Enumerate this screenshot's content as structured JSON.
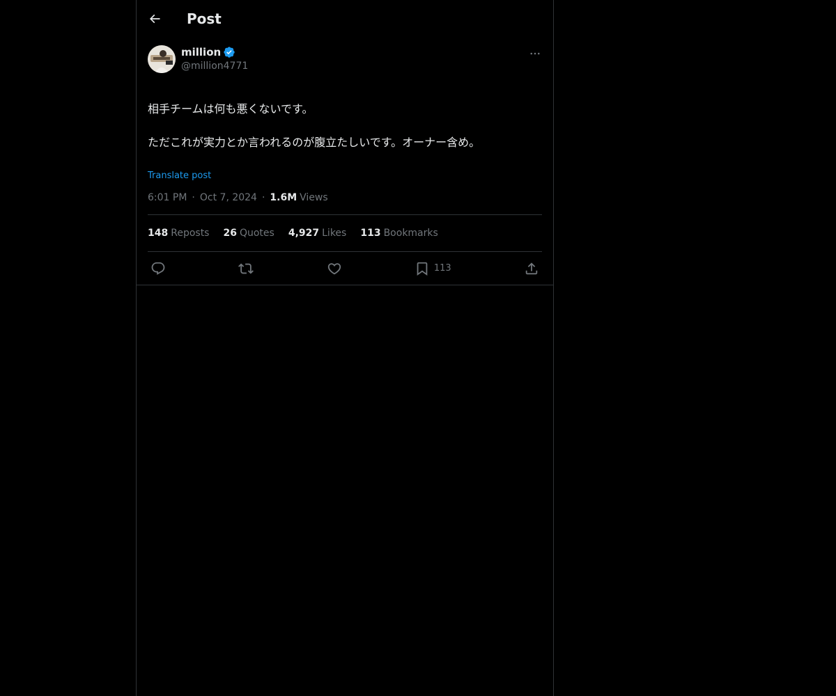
{
  "header": {
    "title": "Post"
  },
  "author": {
    "display_name": "million",
    "handle": "@million4771",
    "verified": true,
    "verified_color": "#1d9bf0"
  },
  "post": {
    "line1": "相手チームは何も悪くないです。",
    "line2": "ただこれが実力とか言われるのが腹立たしいです。オーナー含め。",
    "translate_label": "Translate post"
  },
  "meta": {
    "time": "6:01 PM",
    "date": "Oct 7, 2024",
    "views_count": "1.6M",
    "views_label": "Views"
  },
  "stats": {
    "reposts_count": "148",
    "reposts_label": "Reposts",
    "quotes_count": "26",
    "quotes_label": "Quotes",
    "likes_count": "4,927",
    "likes_label": "Likes",
    "bookmarks_count": "113",
    "bookmarks_label": "Bookmarks"
  },
  "actions": {
    "bookmark_count": "113",
    "icons": [
      "reply-icon",
      "repost-icon",
      "like-icon",
      "bookmark-icon",
      "share-icon"
    ]
  },
  "colors": {
    "background": "#000000",
    "text": "#e7e9ea",
    "muted": "#71767b",
    "accent": "#1d9bf0",
    "border": "#2f3336"
  }
}
